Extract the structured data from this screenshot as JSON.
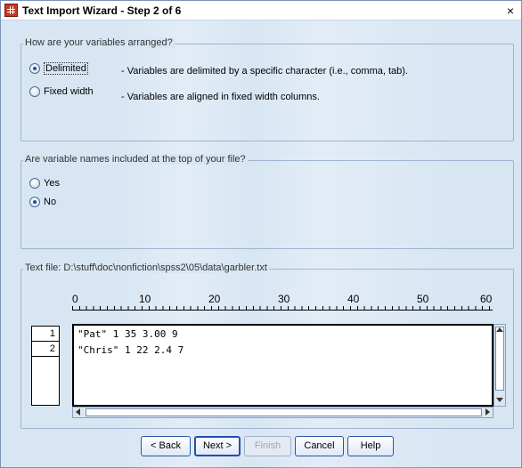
{
  "window": {
    "title": "Text Import Wizard - Step 2 of 6",
    "close_symbol": "×"
  },
  "arrangement": {
    "legend": "How are your variables arranged?",
    "options": [
      {
        "label": "Delimited",
        "description": "- Variables are delimited by a specific character (i.e., comma, tab).",
        "selected": true
      },
      {
        "label": "Fixed width",
        "description": "- Variables are aligned in fixed width columns.",
        "selected": false
      }
    ]
  },
  "variable_names": {
    "legend": "Are variable names included at the top of your file?",
    "options": [
      {
        "label": "Yes",
        "selected": false
      },
      {
        "label": "No",
        "selected": true
      }
    ]
  },
  "text_file": {
    "legend": "Text file:  D:\\stuff\\doc\\nonfiction\\spss2\\05\\data\\garbler.txt",
    "ruler_labels": [
      "0",
      "10",
      "20",
      "30",
      "40",
      "50",
      "60"
    ],
    "row_numbers": [
      "1",
      "2"
    ],
    "lines": [
      "\"Pat\" 1 35 3.00 9",
      "\"Chris\" 1 22 2.4 7"
    ]
  },
  "buttons": {
    "back": "< Back",
    "next": "Next >",
    "finish": "Finish",
    "cancel": "Cancel",
    "help": "Help"
  },
  "colors": {
    "window_background": "#d8e6f3",
    "button_border": "#2a55a4"
  }
}
